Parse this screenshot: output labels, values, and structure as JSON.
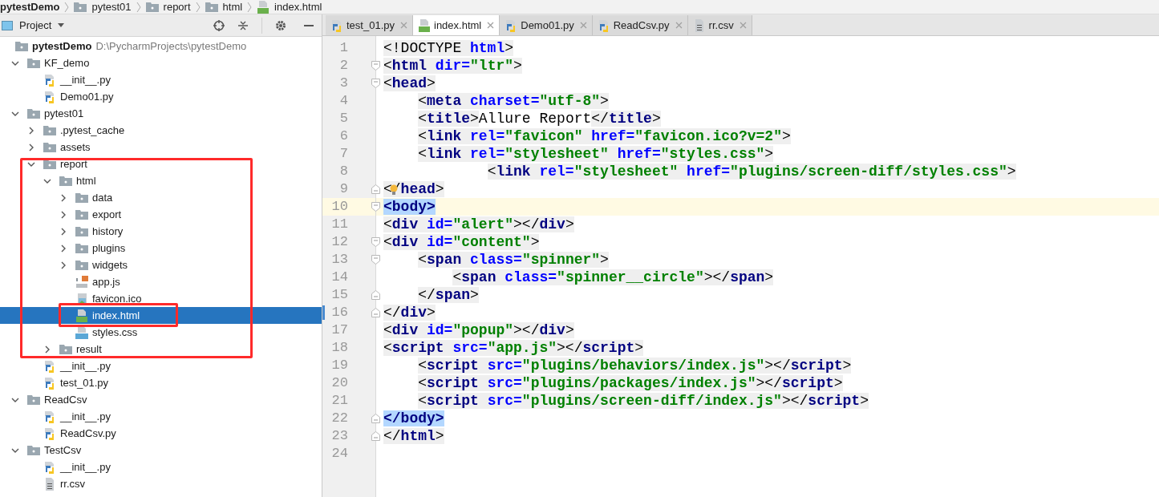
{
  "breadcrumb": [
    {
      "label": "pytestDemo",
      "kind": "root"
    },
    {
      "label": "pytest01",
      "kind": "folder"
    },
    {
      "label": "report",
      "kind": "folder"
    },
    {
      "label": "html",
      "kind": "folder"
    },
    {
      "label": "index.html",
      "kind": "html"
    }
  ],
  "project_panel": {
    "title": "Project"
  },
  "tree": [
    {
      "name": "pytestDemo",
      "kind": "root",
      "path": "D:\\PycharmProjects\\pytestDemo",
      "selected": false,
      "children": [
        {
          "name": "KF_demo",
          "kind": "folder",
          "expanded": true,
          "selected": false,
          "children": [
            {
              "name": "__init__.py",
              "kind": "py",
              "selected": false
            },
            {
              "name": "Demo01.py",
              "kind": "py",
              "selected": false
            }
          ]
        },
        {
          "name": "pytest01",
          "kind": "folder",
          "expanded": true,
          "selected": false,
          "children": [
            {
              "name": ".pytest_cache",
              "kind": "folder",
              "expanded": false,
              "selected": false
            },
            {
              "name": "assets",
              "kind": "folder",
              "expanded": false,
              "selected": false
            },
            {
              "name": "report",
              "kind": "folder",
              "expanded": true,
              "selected": false,
              "children": [
                {
                  "name": "html",
                  "kind": "folder",
                  "expanded": true,
                  "selected": false,
                  "children": [
                    {
                      "name": "data",
                      "kind": "folder",
                      "expanded": false,
                      "selected": false
                    },
                    {
                      "name": "export",
                      "kind": "folder",
                      "expanded": false,
                      "selected": false
                    },
                    {
                      "name": "history",
                      "kind": "folder",
                      "expanded": false,
                      "selected": false
                    },
                    {
                      "name": "plugins",
                      "kind": "folder",
                      "expanded": false,
                      "selected": false
                    },
                    {
                      "name": "widgets",
                      "kind": "folder",
                      "expanded": false,
                      "selected": false
                    },
                    {
                      "name": "app.js",
                      "kind": "js",
                      "selected": false
                    },
                    {
                      "name": "favicon.ico",
                      "kind": "ico",
                      "selected": false
                    },
                    {
                      "name": "index.html",
                      "kind": "html",
                      "selected": true
                    },
                    {
                      "name": "styles.css",
                      "kind": "css",
                      "selected": false
                    }
                  ]
                },
                {
                  "name": "result",
                  "kind": "folder",
                  "expanded": false,
                  "selected": false
                }
              ]
            },
            {
              "name": "__init__.py",
              "kind": "py",
              "selected": false
            },
            {
              "name": "test_01.py",
              "kind": "py",
              "selected": false
            }
          ]
        },
        {
          "name": "ReadCsv",
          "kind": "folder",
          "expanded": true,
          "selected": false,
          "children": [
            {
              "name": "__init__.py",
              "kind": "py",
              "selected": false
            },
            {
              "name": "ReadCsv.py",
              "kind": "py",
              "selected": false
            }
          ]
        },
        {
          "name": "TestCsv",
          "kind": "folder",
          "expanded": true,
          "selected": false,
          "children": [
            {
              "name": "__init__.py",
              "kind": "py",
              "selected": false
            },
            {
              "name": "rr.csv",
              "kind": "csv",
              "selected": false
            }
          ]
        }
      ]
    }
  ],
  "tabs": [
    {
      "label": "test_01.py",
      "kind": "py",
      "selected": false
    },
    {
      "label": "index.html",
      "kind": "html",
      "selected": true
    },
    {
      "label": "Demo01.py",
      "kind": "py",
      "selected": false
    },
    {
      "label": "ReadCsv.py",
      "kind": "py",
      "selected": false
    },
    {
      "label": "rr.csv",
      "kind": "csv",
      "selected": false
    }
  ],
  "code_lines": [
    {
      "number": "1",
      "tokens": [
        {
          "kind": "p",
          "text": "<!DOCTYPE"
        },
        {
          "kind": "a",
          "text": " html"
        },
        {
          "kind": "p",
          "text": ">"
        }
      ]
    },
    {
      "number": "2",
      "fold_start": true,
      "tokens": [
        {
          "kind": "p",
          "text": "<"
        },
        {
          "kind": "t",
          "text": "html"
        },
        {
          "kind": "a",
          "text": " dir="
        },
        {
          "kind": "s",
          "text": "\"ltr\""
        },
        {
          "kind": "p",
          "text": ">"
        }
      ]
    },
    {
      "number": "3",
      "fold_start": true,
      "tokens": [
        {
          "kind": "p",
          "text": "<"
        },
        {
          "kind": "t",
          "text": "head"
        },
        {
          "kind": "p",
          "text": ">"
        }
      ]
    },
    {
      "number": "4",
      "tokens": [
        {
          "kind": "p",
          "text": "    <"
        },
        {
          "kind": "t",
          "text": "meta"
        },
        {
          "kind": "a",
          "text": " charset="
        },
        {
          "kind": "s",
          "text": "\"utf-8\""
        },
        {
          "kind": "p",
          "text": ">"
        }
      ]
    },
    {
      "number": "5",
      "tokens": [
        {
          "kind": "p",
          "text": "    <"
        },
        {
          "kind": "t",
          "text": "title"
        },
        {
          "kind": "p",
          "text": ">"
        },
        {
          "kind": "x",
          "text": "Allure Report"
        },
        {
          "kind": "p",
          "text": "</"
        },
        {
          "kind": "t",
          "text": "title"
        },
        {
          "kind": "p",
          "text": ">"
        }
      ]
    },
    {
      "number": "6",
      "tokens": [
        {
          "kind": "p",
          "text": "    <"
        },
        {
          "kind": "t",
          "text": "link"
        },
        {
          "kind": "a",
          "text": " rel="
        },
        {
          "kind": "s",
          "text": "\"favicon\""
        },
        {
          "kind": "a",
          "text": " href="
        },
        {
          "kind": "s",
          "text": "\"favicon.ico?v=2\""
        },
        {
          "kind": "p",
          "text": ">"
        }
      ]
    },
    {
      "number": "7",
      "tokens": [
        {
          "kind": "p",
          "text": "    <"
        },
        {
          "kind": "t",
          "text": "link"
        },
        {
          "kind": "a",
          "text": " rel="
        },
        {
          "kind": "s",
          "text": "\"stylesheet\""
        },
        {
          "kind": "a",
          "text": " href="
        },
        {
          "kind": "s",
          "text": "\"styles.css\""
        },
        {
          "kind": "p",
          "text": ">"
        }
      ]
    },
    {
      "number": "8",
      "tokens": [
        {
          "kind": "p",
          "text": "            <"
        },
        {
          "kind": "t",
          "text": "link"
        },
        {
          "kind": "a",
          "text": " rel="
        },
        {
          "kind": "s",
          "text": "\"stylesheet\""
        },
        {
          "kind": "a",
          "text": " href="
        },
        {
          "kind": "s",
          "text": "\"plugins/screen-diff/styles.css\""
        },
        {
          "kind": "p",
          "text": ">"
        }
      ]
    },
    {
      "number": "9",
      "fold_end": true,
      "intention": true,
      "tokens": [
        {
          "kind": "p",
          "text": "</"
        },
        {
          "kind": "t",
          "text": "head"
        },
        {
          "kind": "p",
          "text": ">"
        }
      ]
    },
    {
      "number": "10",
      "fold_start": true,
      "current": true,
      "tokens": [
        {
          "kind": "m",
          "text": "<body>"
        }
      ]
    },
    {
      "number": "11",
      "tokens": [
        {
          "kind": "p",
          "text": "<"
        },
        {
          "kind": "t",
          "text": "div"
        },
        {
          "kind": "a",
          "text": " id="
        },
        {
          "kind": "s",
          "text": "\"alert\""
        },
        {
          "kind": "p",
          "text": "></"
        },
        {
          "kind": "t",
          "text": "div"
        },
        {
          "kind": "p",
          "text": ">"
        }
      ]
    },
    {
      "number": "12",
      "fold_start": true,
      "tokens": [
        {
          "kind": "p",
          "text": "<"
        },
        {
          "kind": "t",
          "text": "div"
        },
        {
          "kind": "a",
          "text": " id="
        },
        {
          "kind": "s",
          "text": "\"content\""
        },
        {
          "kind": "p",
          "text": ">"
        }
      ]
    },
    {
      "number": "13",
      "fold_start": true,
      "tokens": [
        {
          "kind": "p",
          "text": "    <"
        },
        {
          "kind": "t",
          "text": "span"
        },
        {
          "kind": "a",
          "text": " class="
        },
        {
          "kind": "s",
          "text": "\"spinner\""
        },
        {
          "kind": "p",
          "text": ">"
        }
      ]
    },
    {
      "number": "14",
      "tokens": [
        {
          "kind": "p",
          "text": "        <"
        },
        {
          "kind": "t",
          "text": "span"
        },
        {
          "kind": "a",
          "text": " class="
        },
        {
          "kind": "s",
          "text": "\"spinner__circle\""
        },
        {
          "kind": "p",
          "text": "></"
        },
        {
          "kind": "t",
          "text": "span"
        },
        {
          "kind": "p",
          "text": ">"
        }
      ]
    },
    {
      "number": "15",
      "fold_end": true,
      "tokens": [
        {
          "kind": "p",
          "text": "    </"
        },
        {
          "kind": "t",
          "text": "span"
        },
        {
          "kind": "p",
          "text": ">"
        }
      ]
    },
    {
      "number": "16",
      "fold_end": true,
      "changed": true,
      "tokens": [
        {
          "kind": "p",
          "text": "</"
        },
        {
          "kind": "t",
          "text": "div"
        },
        {
          "kind": "p",
          "text": ">"
        }
      ]
    },
    {
      "number": "17",
      "tokens": [
        {
          "kind": "p",
          "text": "<"
        },
        {
          "kind": "t",
          "text": "div"
        },
        {
          "kind": "a",
          "text": " id="
        },
        {
          "kind": "s",
          "text": "\"popup\""
        },
        {
          "kind": "p",
          "text": "></"
        },
        {
          "kind": "t",
          "text": "div"
        },
        {
          "kind": "p",
          "text": ">"
        }
      ]
    },
    {
      "number": "18",
      "tokens": [
        {
          "kind": "p",
          "text": "<"
        },
        {
          "kind": "t",
          "text": "script"
        },
        {
          "kind": "a",
          "text": " src="
        },
        {
          "kind": "s",
          "text": "\"app.js\""
        },
        {
          "kind": "p",
          "text": "></"
        },
        {
          "kind": "t",
          "text": "script"
        },
        {
          "kind": "p",
          "text": ">"
        }
      ]
    },
    {
      "number": "19",
      "tokens": [
        {
          "kind": "p",
          "text": "    <"
        },
        {
          "kind": "t",
          "text": "script"
        },
        {
          "kind": "a",
          "text": " src="
        },
        {
          "kind": "s",
          "text": "\"plugins/behaviors/index.js\""
        },
        {
          "kind": "p",
          "text": "></"
        },
        {
          "kind": "t",
          "text": "script"
        },
        {
          "kind": "p",
          "text": ">"
        }
      ]
    },
    {
      "number": "20",
      "tokens": [
        {
          "kind": "p",
          "text": "    <"
        },
        {
          "kind": "t",
          "text": "script"
        },
        {
          "kind": "a",
          "text": " src="
        },
        {
          "kind": "s",
          "text": "\"plugins/packages/index.js\""
        },
        {
          "kind": "p",
          "text": "></"
        },
        {
          "kind": "t",
          "text": "script"
        },
        {
          "kind": "p",
          "text": ">"
        }
      ]
    },
    {
      "number": "21",
      "tokens": [
        {
          "kind": "p",
          "text": "    <"
        },
        {
          "kind": "t",
          "text": "script"
        },
        {
          "kind": "a",
          "text": " src="
        },
        {
          "kind": "s",
          "text": "\"plugins/screen-diff/index.js\""
        },
        {
          "kind": "p",
          "text": "></"
        },
        {
          "kind": "t",
          "text": "script"
        },
        {
          "kind": "p",
          "text": ">"
        }
      ]
    },
    {
      "number": "22",
      "fold_end": true,
      "tokens": [
        {
          "kind": "m",
          "text": "</body>"
        }
      ]
    },
    {
      "number": "23",
      "fold_end": true,
      "tokens": [
        {
          "kind": "p",
          "text": "</"
        },
        {
          "kind": "t",
          "text": "html"
        },
        {
          "kind": "p",
          "text": ">"
        }
      ]
    },
    {
      "number": "24"
    }
  ]
}
